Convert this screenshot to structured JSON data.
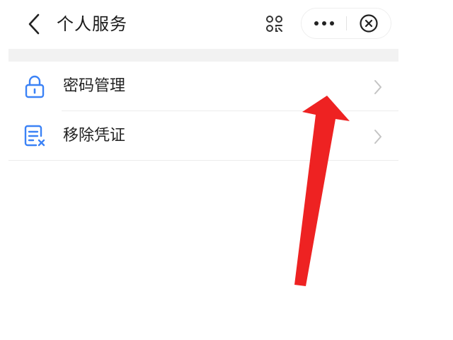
{
  "header": {
    "title": "个人服务"
  },
  "list": {
    "items": [
      {
        "label": "密码管理",
        "icon": "lock-icon"
      },
      {
        "label": "移除凭证",
        "icon": "remove-credential-icon"
      }
    ]
  },
  "colors": {
    "accent_blue": "#3b82f6",
    "annotation_red": "#ee2222",
    "text_primary": "#1a1a1a",
    "chevron_gray": "#c4c4c4"
  },
  "icons": {
    "back": "back-chevron-icon",
    "scan": "scan-icon",
    "more": "more-dots-icon",
    "close": "close-circle-icon",
    "row_arrow": "chevron-right-icon",
    "annotation": "red-arrow-annotation"
  }
}
